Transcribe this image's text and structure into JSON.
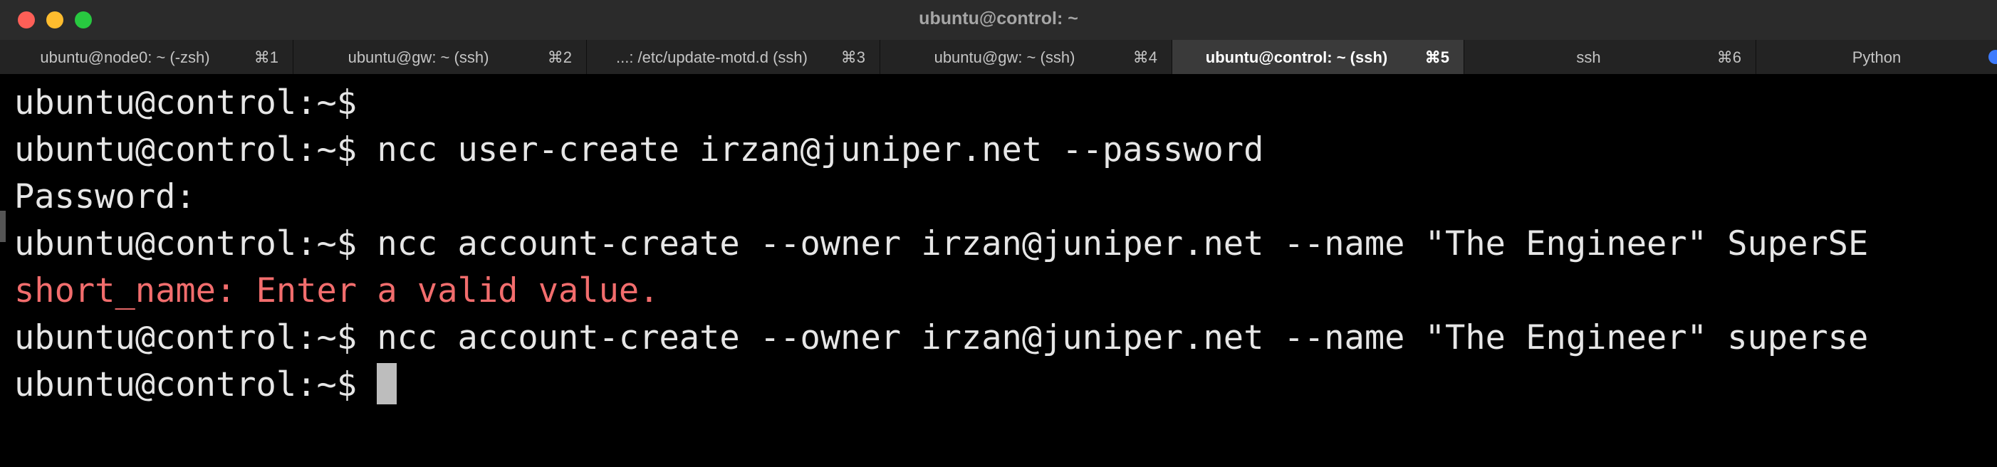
{
  "window": {
    "title": "ubuntu@control: ~"
  },
  "tabs": [
    {
      "label": "ubuntu@node0: ~ (-zsh)",
      "shortcut": "⌘1",
      "active": false
    },
    {
      "label": "ubuntu@gw: ~ (ssh)",
      "shortcut": "⌘2",
      "active": false
    },
    {
      "label": "...: /etc/update-motd.d (ssh)",
      "shortcut": "⌘3",
      "active": false
    },
    {
      "label": "ubuntu@gw: ~ (ssh)",
      "shortcut": "⌘4",
      "active": false
    },
    {
      "label": "ubuntu@control: ~ (ssh)",
      "shortcut": "⌘5",
      "active": true
    },
    {
      "label": "ssh",
      "shortcut": "⌘6",
      "active": false
    },
    {
      "label": "Python",
      "shortcut": "",
      "active": false
    }
  ],
  "terminal": {
    "lines": [
      {
        "text": "ubuntu@control:~$",
        "type": "prompt"
      },
      {
        "text": "ubuntu@control:~$ ncc user-create irzan@juniper.net --password",
        "type": "prompt"
      },
      {
        "text": "Password:",
        "type": "output"
      },
      {
        "text": "ubuntu@control:~$ ncc account-create --owner irzan@juniper.net --name \"The Engineer\" SuperSE",
        "type": "prompt"
      },
      {
        "text": "short_name: Enter a valid value.",
        "type": "error"
      },
      {
        "text": "ubuntu@control:~$ ncc account-create --owner irzan@juniper.net --name \"The Engineer\" superse",
        "type": "prompt"
      },
      {
        "text": "ubuntu@control:~$ ",
        "type": "prompt"
      }
    ]
  },
  "colors": {
    "background": "#000000",
    "foreground": "#e6e6e6",
    "error": "#f26d6d",
    "cursor": "#bdbdbd",
    "active_tab": "#3a3a3a",
    "tab_activity_indicator": "#3d7bfd"
  }
}
